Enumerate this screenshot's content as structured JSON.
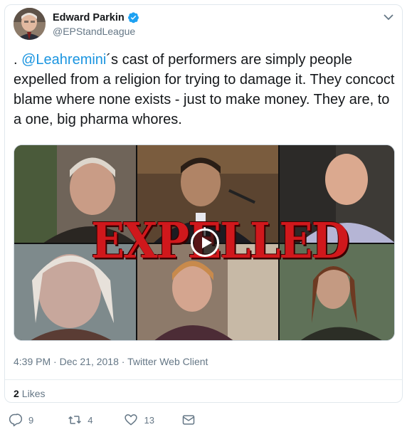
{
  "author": {
    "name": "Edward Parkin",
    "handle": "@EPStandLeague"
  },
  "tweet": {
    "prefix": ". ",
    "mention": "@Leahremini",
    "body": "´s cast of performers are simply people expelled from a religion for trying to damage it. They concoct blame where none exists - just to make money. They are, to a one, big pharma whores."
  },
  "media": {
    "overlay_text": "EXPELLED"
  },
  "meta": {
    "time": "4:39 PM",
    "separator1": "·",
    "date": "Dec 21, 2018",
    "separator2": "·",
    "client": "Twitter Web Client"
  },
  "likes": {
    "count": "2",
    "label": "Likes"
  },
  "actions": {
    "replies": "9",
    "retweets": "4",
    "likes": "13"
  },
  "colors": {
    "accent": "#1b95e0",
    "muted": "#657786",
    "expelled_red": "#d0181c"
  }
}
